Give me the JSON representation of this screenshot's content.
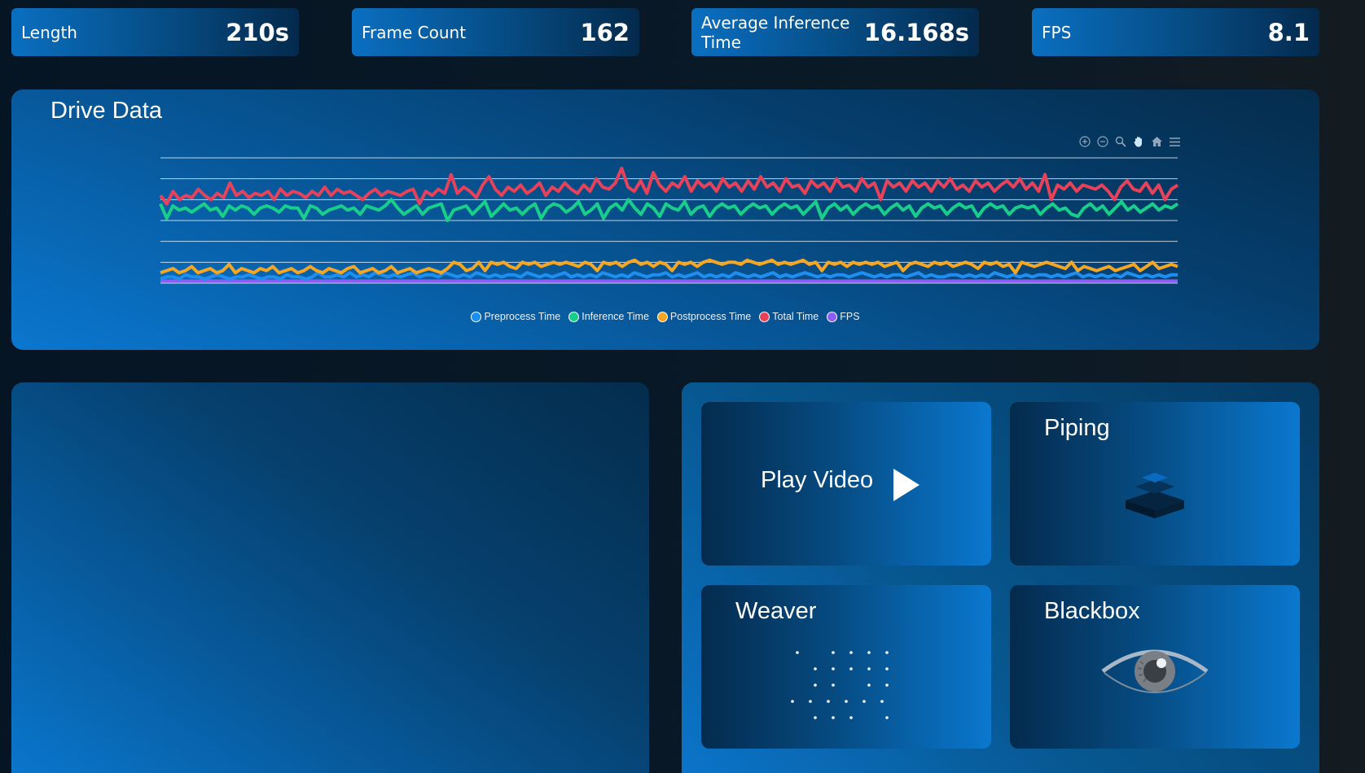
{
  "stats": [
    {
      "label": "Length",
      "value": "210s"
    },
    {
      "label": "Frame Count",
      "value": "162"
    },
    {
      "label": "Average Inference Time",
      "value": "16.168s"
    },
    {
      "label": "FPS",
      "value": "8.1"
    }
  ],
  "chart_panel": {
    "title": "Drive Data",
    "toolbar": [
      "zoom-in-icon",
      "zoom-out-icon",
      "zoom-selection-icon",
      "pan-hand-icon",
      "reset-home-icon",
      "menu-icon"
    ]
  },
  "chart_data": {
    "type": "line",
    "title": "Drive Data",
    "xlabel": "",
    "ylabel": "",
    "ylim": [
      0,
      0.6
    ],
    "grid": true,
    "legend_position": "bottom",
    "series": [
      {
        "name": "Preprocess Time",
        "color": "#1e8ff0",
        "values": [
          0.02,
          0.03,
          0.03,
          0.02,
          0.04,
          0.03,
          0.03,
          0.02,
          0.03,
          0.04,
          0.03,
          0.02,
          0.03,
          0.03,
          0.04,
          0.03,
          0.02,
          0.03,
          0.03,
          0.02,
          0.04,
          0.03,
          0.03,
          0.02,
          0.03,
          0.05,
          0.03,
          0.03,
          0.04,
          0.03,
          0.05,
          0.03,
          0.04,
          0.03,
          0.05,
          0.04,
          0.03,
          0.04,
          0.03,
          0.04,
          0.05,
          0.03,
          0.04,
          0.04,
          0.03,
          0.05,
          0.04,
          0.03,
          0.04,
          0.03,
          0.05,
          0.04,
          0.03,
          0.04,
          0.03,
          0.04,
          0.04,
          0.03,
          0.05,
          0.04,
          0.03,
          0.04,
          0.03,
          0.04,
          0.05,
          0.03,
          0.04,
          0.03,
          0.04,
          0.03,
          0.05,
          0.04,
          0.03,
          0.04,
          0.03,
          0.05,
          0.04,
          0.03,
          0.04,
          0.04,
          0.05,
          0.03,
          0.04,
          0.03,
          0.04,
          0.05,
          0.03,
          0.04,
          0.03,
          0.04,
          0.03,
          0.05,
          0.04,
          0.03,
          0.04,
          0.03,
          0.04,
          0.05,
          0.03,
          0.04,
          0.03,
          0.04,
          0.05,
          0.04,
          0.03,
          0.04,
          0.03,
          0.04,
          0.04,
          0.03,
          0.04,
          0.05,
          0.04,
          0.03,
          0.04,
          0.03,
          0.04,
          0.04,
          0.03,
          0.04,
          0.05,
          0.03,
          0.04,
          0.03,
          0.03,
          0.04,
          0.04,
          0.03,
          0.04,
          0.03,
          0.04,
          0.03,
          0.05,
          0.04,
          0.03,
          0.04,
          0.03,
          0.04,
          0.03,
          0.04,
          0.04,
          0.03,
          0.04,
          0.03,
          0.04,
          0.05,
          0.03,
          0.04,
          0.03,
          0.04,
          0.03,
          0.04,
          0.03,
          0.05,
          0.04,
          0.03,
          0.04,
          0.03,
          0.04,
          0.03,
          0.04,
          0.04
        ]
      },
      {
        "name": "Inference Time",
        "color": "#17cf8a",
        "values": [
          0.38,
          0.31,
          0.37,
          0.35,
          0.36,
          0.34,
          0.36,
          0.38,
          0.35,
          0.36,
          0.32,
          0.37,
          0.35,
          0.37,
          0.36,
          0.33,
          0.36,
          0.37,
          0.36,
          0.34,
          0.37,
          0.36,
          0.36,
          0.31,
          0.37,
          0.36,
          0.33,
          0.35,
          0.36,
          0.37,
          0.35,
          0.36,
          0.33,
          0.37,
          0.36,
          0.35,
          0.37,
          0.4,
          0.36,
          0.33,
          0.35,
          0.37,
          0.33,
          0.36,
          0.37,
          0.38,
          0.3,
          0.35,
          0.36,
          0.37,
          0.33,
          0.36,
          0.39,
          0.32,
          0.35,
          0.38,
          0.35,
          0.36,
          0.33,
          0.36,
          0.38,
          0.31,
          0.36,
          0.38,
          0.37,
          0.34,
          0.36,
          0.39,
          0.33,
          0.35,
          0.38,
          0.31,
          0.36,
          0.38,
          0.35,
          0.4,
          0.36,
          0.33,
          0.38,
          0.36,
          0.32,
          0.38,
          0.36,
          0.35,
          0.39,
          0.33,
          0.36,
          0.37,
          0.32,
          0.36,
          0.38,
          0.36,
          0.37,
          0.33,
          0.36,
          0.38,
          0.36,
          0.37,
          0.33,
          0.36,
          0.38,
          0.36,
          0.37,
          0.33,
          0.36,
          0.39,
          0.31,
          0.36,
          0.38,
          0.35,
          0.37,
          0.33,
          0.36,
          0.38,
          0.36,
          0.37,
          0.33,
          0.36,
          0.38,
          0.35,
          0.37,
          0.32,
          0.36,
          0.38,
          0.36,
          0.37,
          0.33,
          0.36,
          0.38,
          0.36,
          0.37,
          0.32,
          0.36,
          0.38,
          0.36,
          0.37,
          0.33,
          0.36,
          0.37,
          0.36,
          0.37,
          0.33,
          0.36,
          0.38,
          0.35,
          0.36,
          0.33,
          0.32,
          0.36,
          0.38,
          0.35,
          0.37,
          0.33,
          0.36,
          0.39,
          0.35,
          0.37,
          0.34,
          0.36,
          0.38,
          0.35,
          0.37,
          0.36,
          0.38
        ]
      },
      {
        "name": "Postprocess Time",
        "color": "#f5a623",
        "values": [
          0.05,
          0.06,
          0.07,
          0.05,
          0.06,
          0.08,
          0.05,
          0.06,
          0.07,
          0.05,
          0.06,
          0.09,
          0.05,
          0.07,
          0.06,
          0.05,
          0.07,
          0.06,
          0.08,
          0.05,
          0.06,
          0.07,
          0.05,
          0.06,
          0.08,
          0.06,
          0.05,
          0.07,
          0.06,
          0.05,
          0.07,
          0.08,
          0.05,
          0.06,
          0.07,
          0.05,
          0.06,
          0.08,
          0.05,
          0.06,
          0.07,
          0.05,
          0.06,
          0.07,
          0.06,
          0.05,
          0.07,
          0.1,
          0.09,
          0.06,
          0.07,
          0.1,
          0.06,
          0.1,
          0.09,
          0.1,
          0.08,
          0.07,
          0.1,
          0.09,
          0.1,
          0.08,
          0.09,
          0.1,
          0.09,
          0.1,
          0.09,
          0.08,
          0.1,
          0.09,
          0.06,
          0.1,
          0.09,
          0.1,
          0.08,
          0.1,
          0.11,
          0.09,
          0.1,
          0.08,
          0.1,
          0.09,
          0.06,
          0.1,
          0.09,
          0.1,
          0.08,
          0.1,
          0.11,
          0.1,
          0.09,
          0.1,
          0.1,
          0.09,
          0.11,
          0.1,
          0.09,
          0.1,
          0.11,
          0.09,
          0.1,
          0.09,
          0.1,
          0.11,
          0.09,
          0.1,
          0.06,
          0.1,
          0.09,
          0.1,
          0.08,
          0.1,
          0.09,
          0.1,
          0.09,
          0.1,
          0.08,
          0.09,
          0.1,
          0.06,
          0.09,
          0.1,
          0.09,
          0.08,
          0.1,
          0.09,
          0.1,
          0.08,
          0.09,
          0.1,
          0.09,
          0.07,
          0.1,
          0.09,
          0.1,
          0.08,
          0.09,
          0.05,
          0.1,
          0.09,
          0.08,
          0.09,
          0.1,
          0.09,
          0.08,
          0.07,
          0.1,
          0.06,
          0.08,
          0.07,
          0.06,
          0.07,
          0.08,
          0.06,
          0.07,
          0.08,
          0.09,
          0.06,
          0.08,
          0.1,
          0.07,
          0.08,
          0.09,
          0.08
        ]
      },
      {
        "name": "Total Time",
        "color": "#e8425a",
        "values": [
          0.42,
          0.38,
          0.44,
          0.4,
          0.42,
          0.41,
          0.45,
          0.42,
          0.4,
          0.43,
          0.41,
          0.48,
          0.42,
          0.44,
          0.41,
          0.43,
          0.42,
          0.44,
          0.4,
          0.45,
          0.42,
          0.44,
          0.43,
          0.41,
          0.44,
          0.42,
          0.46,
          0.42,
          0.45,
          0.43,
          0.44,
          0.42,
          0.4,
          0.43,
          0.45,
          0.42,
          0.44,
          0.43,
          0.42,
          0.44,
          0.45,
          0.38,
          0.44,
          0.42,
          0.45,
          0.43,
          0.52,
          0.43,
          0.46,
          0.44,
          0.41,
          0.47,
          0.51,
          0.45,
          0.42,
          0.46,
          0.44,
          0.47,
          0.43,
          0.45,
          0.48,
          0.42,
          0.46,
          0.44,
          0.48,
          0.45,
          0.43,
          0.47,
          0.44,
          0.5,
          0.46,
          0.45,
          0.48,
          0.55,
          0.46,
          0.44,
          0.49,
          0.43,
          0.53,
          0.47,
          0.44,
          0.48,
          0.46,
          0.51,
          0.44,
          0.49,
          0.46,
          0.48,
          0.44,
          0.5,
          0.46,
          0.48,
          0.44,
          0.49,
          0.45,
          0.51,
          0.46,
          0.48,
          0.44,
          0.5,
          0.46,
          0.47,
          0.43,
          0.49,
          0.46,
          0.48,
          0.44,
          0.5,
          0.46,
          0.47,
          0.44,
          0.5,
          0.46,
          0.48,
          0.4,
          0.49,
          0.46,
          0.48,
          0.44,
          0.49,
          0.46,
          0.48,
          0.44,
          0.49,
          0.46,
          0.5,
          0.45,
          0.47,
          0.44,
          0.49,
          0.46,
          0.48,
          0.44,
          0.47,
          0.49,
          0.46,
          0.5,
          0.45,
          0.48,
          0.44,
          0.52,
          0.4,
          0.47,
          0.45,
          0.48,
          0.44,
          0.47,
          0.46,
          0.45,
          0.47,
          0.44,
          0.4,
          0.46,
          0.49,
          0.45,
          0.44,
          0.48,
          0.43,
          0.47,
          0.4,
          0.45,
          0.47
        ]
      },
      {
        "name": "FPS",
        "color": "#8b5cf6",
        "values": [
          0.01,
          0.01,
          0.01,
          0.01,
          0.01,
          0.01,
          0.01,
          0.01,
          0.01,
          0.01,
          0.01,
          0.01,
          0.01,
          0.01,
          0.01,
          0.01,
          0.01,
          0.01,
          0.01,
          0.01,
          0.01,
          0.01,
          0.01,
          0.01,
          0.01,
          0.01,
          0.01,
          0.01,
          0.01,
          0.01,
          0.01,
          0.01,
          0.01,
          0.01,
          0.01,
          0.01,
          0.01,
          0.01,
          0.01,
          0.01
        ]
      }
    ]
  },
  "apps": {
    "play_video": {
      "label": "Play Video",
      "icon": "play-icon"
    },
    "piping": {
      "label": "Piping",
      "icon": "stacked-layers-icon"
    },
    "weaver": {
      "label": "Weaver",
      "icon": "dot-grid-icon"
    },
    "blackbox": {
      "label": "Blackbox",
      "icon": "eye-icon"
    }
  }
}
